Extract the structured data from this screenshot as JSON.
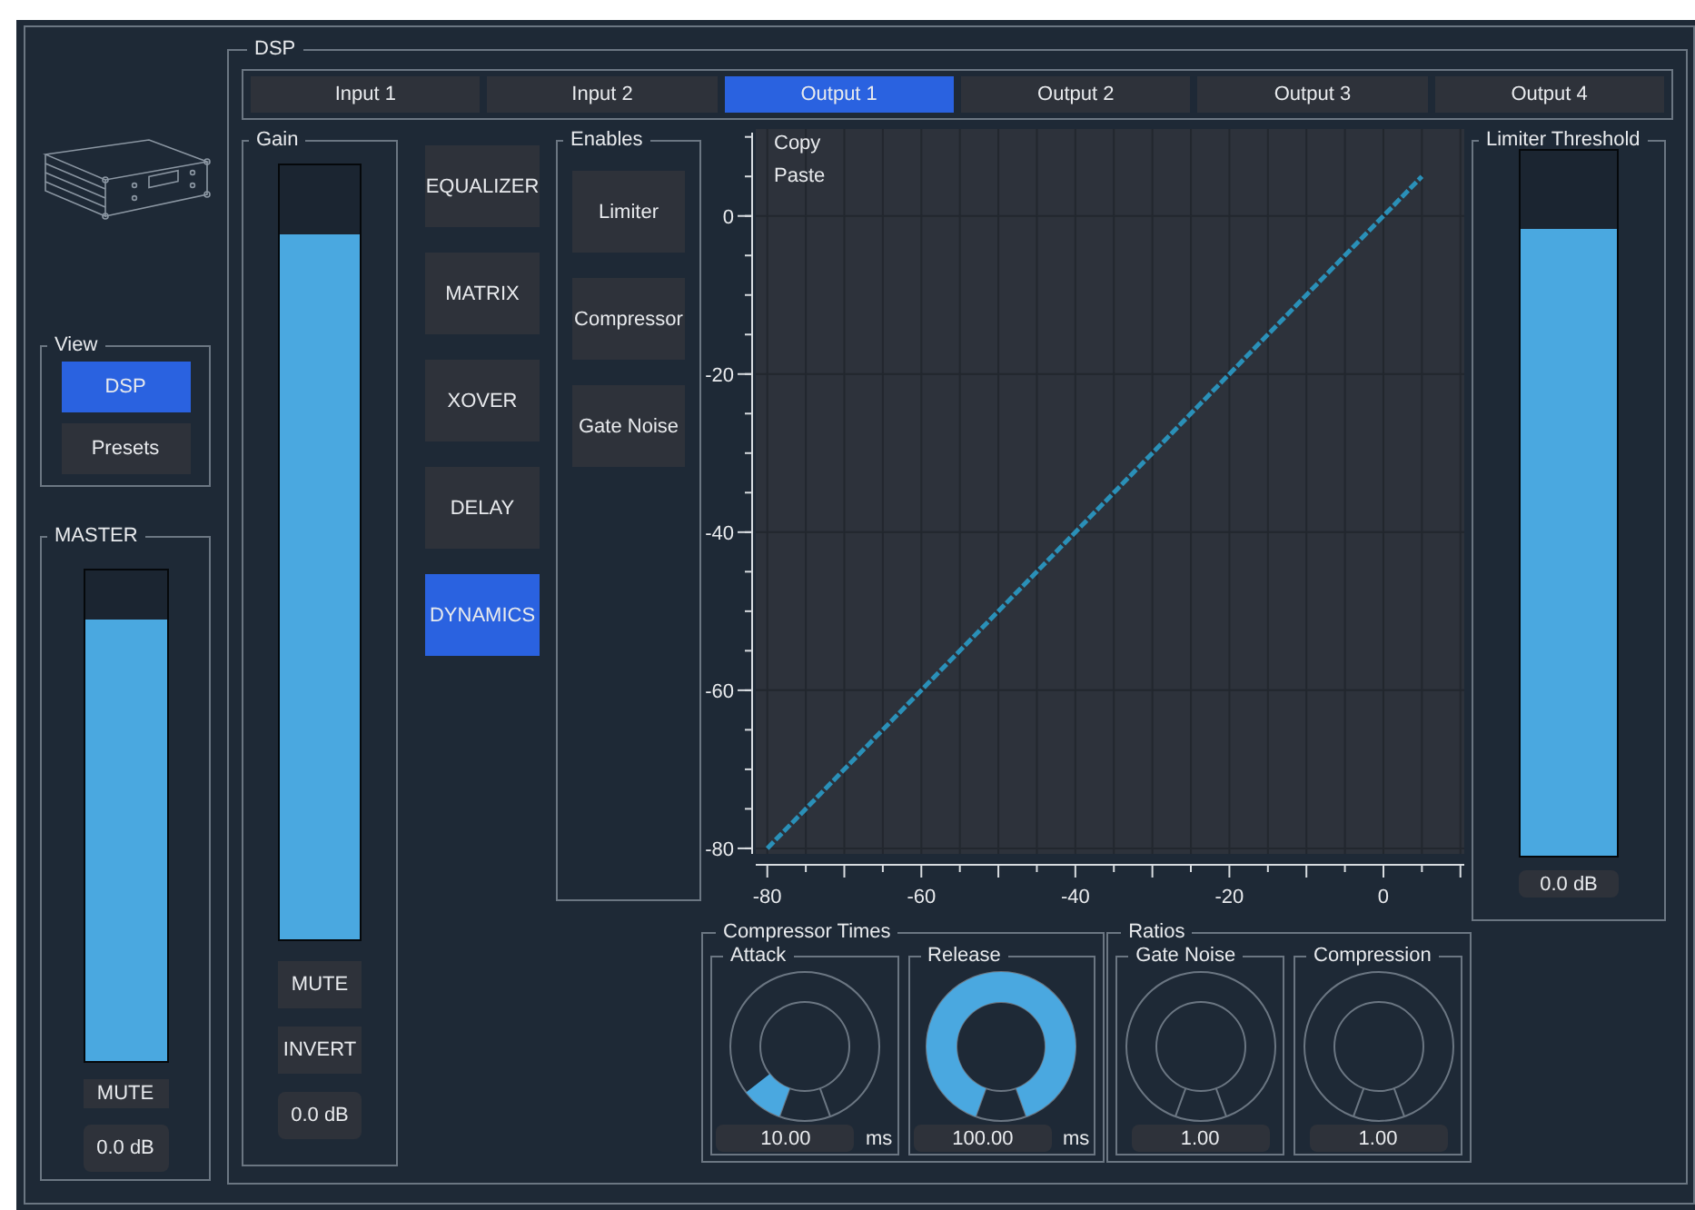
{
  "dsp": {
    "title": "DSP",
    "tabs": [
      {
        "label": "Input 1",
        "selected": false
      },
      {
        "label": "Input 2",
        "selected": false
      },
      {
        "label": "Output 1",
        "selected": true
      },
      {
        "label": "Output 2",
        "selected": false
      },
      {
        "label": "Output 3",
        "selected": false
      },
      {
        "label": "Output 4",
        "selected": false
      }
    ]
  },
  "view": {
    "title": "View",
    "buttons": [
      {
        "label": "DSP",
        "selected": true
      },
      {
        "label": "Presets",
        "selected": false
      }
    ]
  },
  "master": {
    "title": "MASTER",
    "level": 0.9,
    "mute": "MUTE",
    "reading": "0.0 dB"
  },
  "gain": {
    "title": "Gain",
    "level": 0.91,
    "buttons": [
      "MUTE",
      "INVERT"
    ],
    "reading": "0.0 dB"
  },
  "sections": [
    {
      "label": "EQUALIZER",
      "selected": false
    },
    {
      "label": "MATRIX",
      "selected": false
    },
    {
      "label": "XOVER",
      "selected": false
    },
    {
      "label": "DELAY",
      "selected": false
    },
    {
      "label": "DYNAMICS",
      "selected": true
    }
  ],
  "enables": {
    "title": "Enables",
    "buttons": [
      "Limiter",
      "Compressor",
      "Gate Noise"
    ]
  },
  "chart": {
    "buttons": [
      "Copy",
      "Paste"
    ],
    "chart_data": {
      "type": "line",
      "x": [
        -80,
        5
      ],
      "grid": true,
      "series": [
        {
          "color": "#2a90b8",
          "line_style": "dashed",
          "values": [
            -80,
            5
          ]
        }
      ],
      "xlim": [
        -81.5,
        10.5
      ],
      "ylim": [
        -80.7,
        11
      ],
      "xticks": [
        -80,
        -60,
        -40,
        -20,
        0
      ],
      "yticks": [
        0,
        -20,
        -40,
        -60,
        -80
      ]
    }
  },
  "limiter": {
    "title": "Limiter Threshold",
    "level": 0.89,
    "reading": "0.0 dB"
  },
  "knob_groups": [
    {
      "title": "Compressor Times",
      "knobs": [
        {
          "label": "Attack",
          "level": 0.1,
          "value": "10.00",
          "unit": "ms"
        },
        {
          "label": "Release",
          "level": 1,
          "value": "100.00",
          "unit": "ms"
        }
      ]
    },
    {
      "title": "Ratios",
      "knobs": [
        {
          "label": "Gate Noise",
          "level": 0,
          "value": "1.00"
        },
        {
          "label": "Compression",
          "level": 0,
          "value": "1.00"
        }
      ]
    }
  ]
}
